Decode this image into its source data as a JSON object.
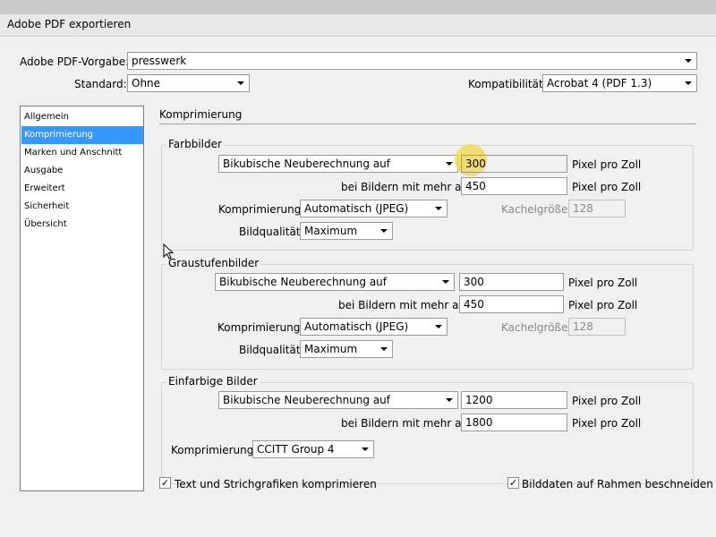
{
  "window": {
    "title": "Adobe PDF exportieren"
  },
  "top": {
    "preset_label": "Adobe PDF-Vorgabe:",
    "preset_value": "presswerk",
    "standard_label": "Standard:",
    "standard_value": "Ohne",
    "compat_label": "Kompatibilität:",
    "compat_value": "Acrobat 4 (PDF 1.3)"
  },
  "sidebar": {
    "items": [
      {
        "label": "Allgemein"
      },
      {
        "label": "Komprimierung"
      },
      {
        "label": "Marken und Anschnitt"
      },
      {
        "label": "Ausgabe"
      },
      {
        "label": "Erweitert"
      },
      {
        "label": "Sicherheit"
      },
      {
        "label": "Übersicht"
      }
    ],
    "active_index": 1
  },
  "section": {
    "title": "Komprimierung"
  },
  "color_images": {
    "title": "Farbbilder",
    "resample_value": "Bikubische Neuberechnung auf",
    "ppi_value": "300",
    "ppi_unit": "Pixel pro Zoll",
    "above_label": "bei Bildern mit mehr als:",
    "above_value": "450",
    "above_unit": "Pixel pro Zoll",
    "compression_label": "Komprimierung:",
    "compression_value": "Automatisch (JPEG)",
    "tile_label": "Kachelgröße:",
    "tile_value": "128",
    "quality_label": "Bildqualität:",
    "quality_value": "Maximum"
  },
  "gray_images": {
    "title": "Graustufenbilder",
    "resample_value": "Bikubische Neuberechnung auf",
    "ppi_value": "300",
    "ppi_unit": "Pixel pro Zoll",
    "above_label": "bei Bildern mit mehr als:",
    "above_value": "450",
    "above_unit": "Pixel pro Zoll",
    "compression_label": "Komprimierung:",
    "compression_value": "Automatisch (JPEG)",
    "tile_label": "Kachelgröße:",
    "tile_value": "128",
    "quality_label": "Bildqualität:",
    "quality_value": "Maximum"
  },
  "mono_images": {
    "title": "Einfarbige Bilder",
    "resample_value": "Bikubische Neuberechnung auf",
    "ppi_value": "1200",
    "ppi_unit": "Pixel pro Zoll",
    "above_label": "bei Bildern mit mehr als:",
    "above_value": "1800",
    "above_unit": "Pixel pro Zoll",
    "compression_label": "Komprimierung:",
    "compression_value": "CCITT Group 4"
  },
  "options": {
    "compress_text_label": "Text und Strichgrafiken komprimieren",
    "compress_text_checked": true,
    "crop_label": "Bilddaten auf Rahmen beschneiden",
    "crop_checked": true
  },
  "icons": {
    "checkmark": "✓"
  }
}
